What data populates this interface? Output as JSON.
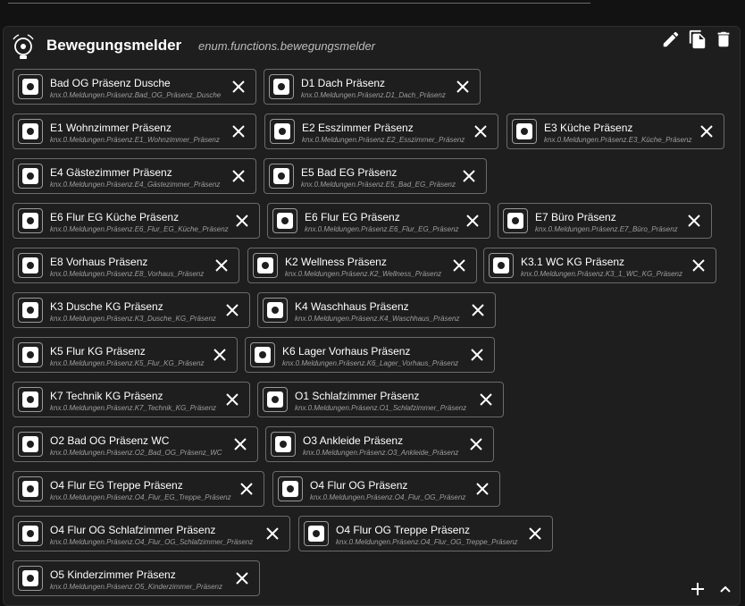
{
  "header": {
    "title": "Bewegungsmelder",
    "subtitle": "enum.functions.bewegungsmelder"
  },
  "toolbar": {
    "edit_icon": "pencil-icon",
    "copy_icon": "copy-icon",
    "delete_icon": "trash-icon"
  },
  "footer": {
    "add_icon": "plus-icon",
    "collapse_icon": "chevron-up-icon"
  },
  "members": [
    {
      "name": "Bad OG Präsenz Dusche",
      "id": "knx.0.Meldungen.Präsenz.Bad_OG_Präsenz_Dusche"
    },
    {
      "name": "D1 Dach Präsenz",
      "id": "knx.0.Meldungen.Präsenz.D1_Dach_Präsenz"
    },
    {
      "name": "E1 Wohnzimmer Präsenz",
      "id": "knx.0.Meldungen.Präsenz.E1_Wohnzimmer_Präsenz"
    },
    {
      "name": "E2 Esszimmer Präsenz",
      "id": "knx.0.Meldungen.Präsenz.E2_Esszimmer_Präsenz"
    },
    {
      "name": "E3 Küche Präsenz",
      "id": "knx.0.Meldungen.Präsenz.E3_Küche_Präsenz"
    },
    {
      "name": "E4 Gästezimmer Präsenz",
      "id": "knx.0.Meldungen.Präsenz.E4_Gästezimmer_Präsenz"
    },
    {
      "name": "E5 Bad EG Präsenz",
      "id": "knx.0.Meldungen.Präsenz.E5_Bad_EG_Präsenz"
    },
    {
      "name": "E6 Flur EG Küche Präsenz",
      "id": "knx.0.Meldungen.Präsenz.E6_Flur_EG_Küche_Präsenz"
    },
    {
      "name": "E6 Flur EG Präsenz",
      "id": "knx.0.Meldungen.Präsenz.E6_Flur_EG_Präsenz"
    },
    {
      "name": "E7 Büro Präsenz",
      "id": "knx.0.Meldungen.Präsenz.E7_Büro_Präsenz"
    },
    {
      "name": "E8 Vorhaus Präsenz",
      "id": "knx.0.Meldungen.Präsenz.E8_Vorhaus_Präsenz"
    },
    {
      "name": "K2 Wellness Präsenz",
      "id": "knx.0.Meldungen.Präsenz.K2_Wellness_Präsenz"
    },
    {
      "name": "K3.1 WC KG Präsenz",
      "id": "knx.0.Meldungen.Präsenz.K3_1_WC_KG_Präsenz"
    },
    {
      "name": "K3 Dusche KG Präsenz",
      "id": "knx.0.Meldungen.Präsenz.K3_Dusche_KG_Präsenz"
    },
    {
      "name": "K4 Waschhaus Präsenz",
      "id": "knx.0.Meldungen.Präsenz.K4_Waschhaus_Präsenz"
    },
    {
      "name": "K5 Flur KG Präsenz",
      "id": "knx.0.Meldungen.Präsenz.K5_Flur_KG_Präsenz"
    },
    {
      "name": "K6 Lager Vorhaus Präsenz",
      "id": "knx.0.Meldungen.Präsenz.K6_Lager_Vorhaus_Präsenz"
    },
    {
      "name": "K7 Technik KG Präsenz",
      "id": "knx.0.Meldungen.Präsenz.K7_Technik_KG_Präsenz"
    },
    {
      "name": "O1 Schlafzimmer Präsenz",
      "id": "knx.0.Meldungen.Präsenz.O1_Schlafzimmer_Präsenz"
    },
    {
      "name": "O2 Bad OG Präsenz WC",
      "id": "knx.0.Meldungen.Präsenz.O2_Bad_OG_Präsenz_WC"
    },
    {
      "name": "O3 Ankleide Präsenz",
      "id": "knx.0.Meldungen.Präsenz.O3_Ankleide_Präsenz"
    },
    {
      "name": "O4 Flur EG Treppe Präsenz",
      "id": "knx.0.Meldungen.Präsenz.O4_Flur_EG_Treppe_Präsenz"
    },
    {
      "name": "O4 Flur OG Präsenz",
      "id": "knx.0.Meldungen.Präsenz.O4_Flur_OG_Präsenz"
    },
    {
      "name": "O4 Flur OG Schlafzimmer Präsenz",
      "id": "knx.0.Meldungen.Präsenz.O4_Flur_OG_Schlafzimmer_Präsenz"
    },
    {
      "name": "O4 Flur OG Treppe Präsenz",
      "id": "knx.0.Meldungen.Präsenz.O4_Flur_OG_Treppe_Präsenz"
    },
    {
      "name": "O5 Kinderzimmer Präsenz",
      "id": "knx.0.Meldungen.Präsenz.O5_Kinderzimmer_Präsenz"
    }
  ]
}
